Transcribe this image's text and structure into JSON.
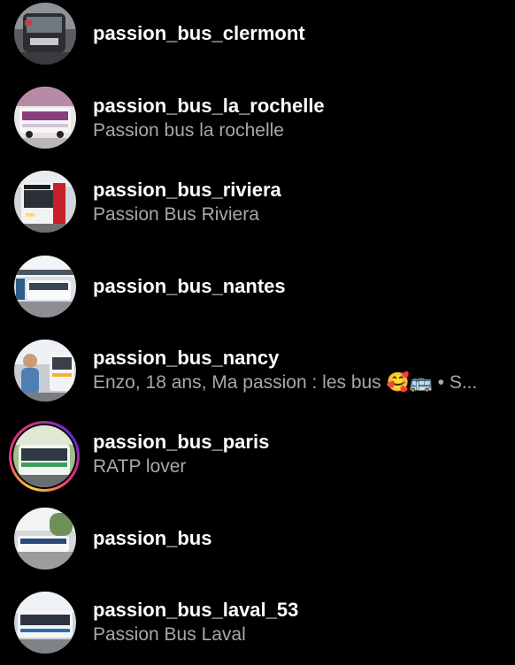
{
  "accounts": [
    {
      "username": "passion_bus_clermont",
      "subtitle": "",
      "avatar": "bus-photo-dark-icon"
    },
    {
      "username": "passion_bus_la_rochelle",
      "subtitle": "Passion bus la rochelle",
      "avatar": "bus-photo-white-icon"
    },
    {
      "username": "passion_bus_riviera",
      "subtitle": "Passion Bus Riviera",
      "avatar": "bus-photo-red-icon"
    },
    {
      "username": "passion_bus_nantes",
      "subtitle": "",
      "avatar": "bus-station-photo-icon"
    },
    {
      "username": "passion_bus_nancy",
      "subtitle": "Enzo, 18 ans, Ma passion : les bus 🥰🚌 • S...",
      "avatar": "person-with-bus-photo-icon"
    },
    {
      "username": "passion_bus_paris",
      "subtitle": "RATP lover",
      "avatar": "bus-photo-green-icon",
      "has_story": true
    },
    {
      "username": "passion_bus",
      "subtitle": "",
      "avatar": "bus-road-photo-icon"
    },
    {
      "username": "passion_bus_laval_53",
      "subtitle": "Passion Bus Laval",
      "avatar": "bus-photo-blue-icon"
    }
  ],
  "colors": {
    "background": "#000000",
    "username": "#ffffff",
    "subtitle": "#a8a8a8",
    "story_ring": [
      "#f9ce34",
      "#ee2a7b",
      "#6228d7"
    ]
  }
}
